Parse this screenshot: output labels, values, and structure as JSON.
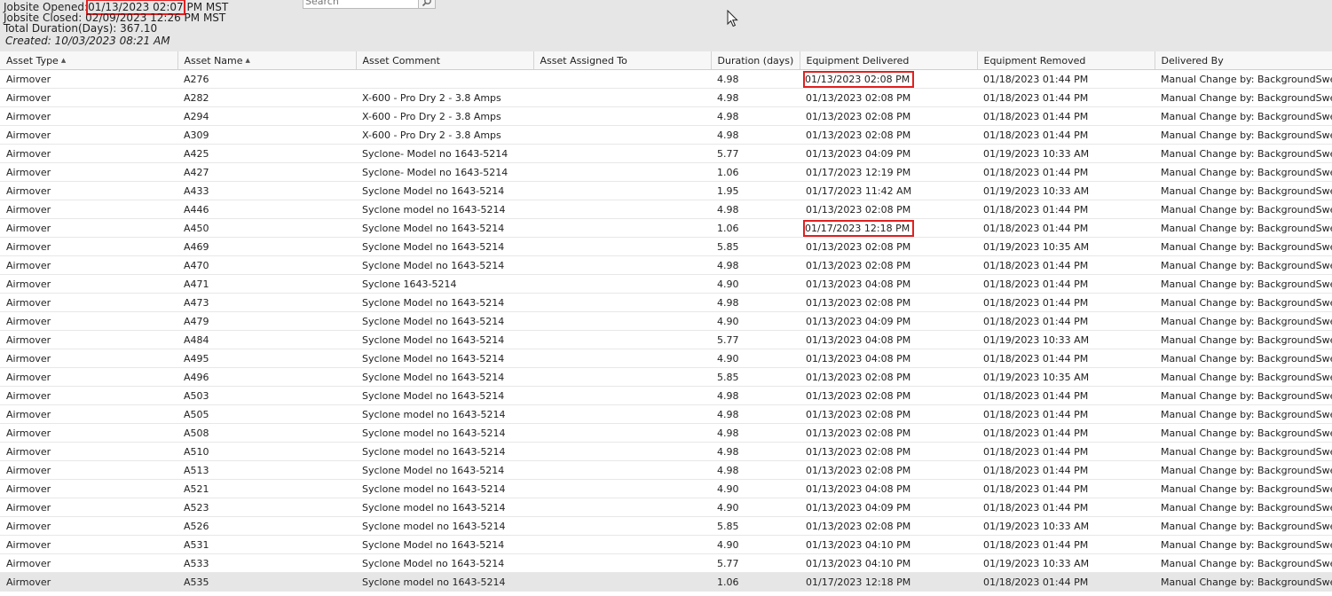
{
  "header": {
    "opened_label": "Jobsite Opened:",
    "opened_value": "01/13/2023 02:07",
    "opened_suffix": "PM MST",
    "closed_label": "Jobsite Closed:",
    "closed_value": "02/09/2023 12:26 PM MST",
    "duration_label": "Total Duration(Days):",
    "duration_value": "367.10",
    "created_label": "Created:",
    "created_value": "10/03/2023 08:21 AM"
  },
  "search": {
    "placeholder": "Search",
    "icon": "magnifier-icon"
  },
  "table": {
    "columns": [
      {
        "label": "Asset Type",
        "sorted": "asc",
        "width": 200
      },
      {
        "label": "Asset Name",
        "sorted": "asc",
        "width": 201
      },
      {
        "label": "Asset Comment",
        "sorted": "",
        "width": 200
      },
      {
        "label": "Asset Assigned To",
        "sorted": "",
        "width": 200
      },
      {
        "label": "Duration (days)",
        "sorted": "",
        "width": 100
      },
      {
        "label": "Equipment Delivered",
        "sorted": "",
        "width": 200
      },
      {
        "label": "Equipment Removed",
        "sorted": "",
        "width": 200
      },
      {
        "label": "Delivered By",
        "sorted": "",
        "width": 200
      }
    ],
    "rows": [
      [
        "Airmover",
        "A276",
        "",
        "",
        "4.98",
        "01/13/2023 02:08 PM",
        "01/18/2023 01:44 PM",
        "Manual Change by: BackgroundSweep"
      ],
      [
        "Airmover",
        "A282",
        "X-600 - Pro Dry 2 - 3.8 Amps",
        "",
        "4.98",
        "01/13/2023 02:08 PM",
        "01/18/2023 01:44 PM",
        "Manual Change by: BackgroundSweep"
      ],
      [
        "Airmover",
        "A294",
        "X-600 - Pro Dry 2 - 3.8 Amps",
        "",
        "4.98",
        "01/13/2023 02:08 PM",
        "01/18/2023 01:44 PM",
        "Manual Change by: BackgroundSweep"
      ],
      [
        "Airmover",
        "A309",
        "X-600 - Pro Dry 2 - 3.8 Amps",
        "",
        "4.98",
        "01/13/2023 02:08 PM",
        "01/18/2023 01:44 PM",
        "Manual Change by: BackgroundSweep"
      ],
      [
        "Airmover",
        "A425",
        "Syclone- Model no 1643-5214",
        "",
        "5.77",
        "01/13/2023 04:09 PM",
        "01/19/2023 10:33 AM",
        "Manual Change by: BackgroundSweep"
      ],
      [
        "Airmover",
        "A427",
        "Syclone- Model no 1643-5214",
        "",
        "1.06",
        "01/17/2023 12:19 PM",
        "01/18/2023 01:44 PM",
        "Manual Change by: BackgroundSweep"
      ],
      [
        "Airmover",
        "A433",
        "Syclone Model no 1643-5214",
        "",
        "1.95",
        "01/17/2023 11:42 AM",
        "01/19/2023 10:33 AM",
        "Manual Change by: BackgroundSweep"
      ],
      [
        "Airmover",
        "A446",
        "Syclone model no 1643-5214",
        "",
        "4.98",
        "01/13/2023 02:08 PM",
        "01/18/2023 01:44 PM",
        "Manual Change by: BackgroundSweep"
      ],
      [
        "Airmover",
        "A450",
        "Syclone Model no 1643-5214",
        "",
        "1.06",
        "01/17/2023 12:18 PM",
        "01/18/2023 01:44 PM",
        "Manual Change by: BackgroundSweep"
      ],
      [
        "Airmover",
        "A469",
        "Syclone Model no 1643-5214",
        "",
        "5.85",
        "01/13/2023 02:08 PM",
        "01/19/2023 10:35 AM",
        "Manual Change by: BackgroundSweep"
      ],
      [
        "Airmover",
        "A470",
        "Syclone Model no 1643-5214",
        "",
        "4.98",
        "01/13/2023 02:08 PM",
        "01/18/2023 01:44 PM",
        "Manual Change by: BackgroundSweep"
      ],
      [
        "Airmover",
        "A471",
        "Syclone 1643-5214",
        "",
        "4.90",
        "01/13/2023 04:08 PM",
        "01/18/2023 01:44 PM",
        "Manual Change by: BackgroundSweep"
      ],
      [
        "Airmover",
        "A473",
        "Syclone Model no 1643-5214",
        "",
        "4.98",
        "01/13/2023 02:08 PM",
        "01/18/2023 01:44 PM",
        "Manual Change by: BackgroundSweep"
      ],
      [
        "Airmover",
        "A479",
        "Syclone Model no 1643-5214",
        "",
        "4.90",
        "01/13/2023 04:09 PM",
        "01/18/2023 01:44 PM",
        "Manual Change by: BackgroundSweep"
      ],
      [
        "Airmover",
        "A484",
        "Syclone Model no 1643-5214",
        "",
        "5.77",
        "01/13/2023 04:08 PM",
        "01/19/2023 10:33 AM",
        "Manual Change by: BackgroundSweep"
      ],
      [
        "Airmover",
        "A495",
        "Syclone Model no 1643-5214",
        "",
        "4.90",
        "01/13/2023 04:08 PM",
        "01/18/2023 01:44 PM",
        "Manual Change by: BackgroundSweep"
      ],
      [
        "Airmover",
        "A496",
        "Syclone Model no 1643-5214",
        "",
        "5.85",
        "01/13/2023 02:08 PM",
        "01/19/2023 10:35 AM",
        "Manual Change by: BackgroundSweep"
      ],
      [
        "Airmover",
        "A503",
        "Syclone Model no 1643-5214",
        "",
        "4.98",
        "01/13/2023 02:08 PM",
        "01/18/2023 01:44 PM",
        "Manual Change by: BackgroundSweep"
      ],
      [
        "Airmover",
        "A505",
        "Syclone model no 1643-5214",
        "",
        "4.98",
        "01/13/2023 02:08 PM",
        "01/18/2023 01:44 PM",
        "Manual Change by: BackgroundSweep"
      ],
      [
        "Airmover",
        "A508",
        "Syclone model no 1643-5214",
        "",
        "4.98",
        "01/13/2023 02:08 PM",
        "01/18/2023 01:44 PM",
        "Manual Change by: BackgroundSweep"
      ],
      [
        "Airmover",
        "A510",
        "Syclone model no 1643-5214",
        "",
        "4.98",
        "01/13/2023 02:08 PM",
        "01/18/2023 01:44 PM",
        "Manual Change by: BackgroundSweep"
      ],
      [
        "Airmover",
        "A513",
        "Syclone Model no 1643-5214",
        "",
        "4.98",
        "01/13/2023 02:08 PM",
        "01/18/2023 01:44 PM",
        "Manual Change by: BackgroundSweep"
      ],
      [
        "Airmover",
        "A521",
        "Syclone model no 1643-5214",
        "",
        "4.90",
        "01/13/2023 04:08 PM",
        "01/18/2023 01:44 PM",
        "Manual Change by: BackgroundSweep"
      ],
      [
        "Airmover",
        "A523",
        "Syclone model no 1643-5214",
        "",
        "4.90",
        "01/13/2023 04:09 PM",
        "01/18/2023 01:44 PM",
        "Manual Change by: BackgroundSweep"
      ],
      [
        "Airmover",
        "A526",
        "Syclone model no 1643-5214",
        "",
        "5.85",
        "01/13/2023 02:08 PM",
        "01/19/2023 10:33 AM",
        "Manual Change by: BackgroundSweep"
      ],
      [
        "Airmover",
        "A531",
        "Syclone Model no 1643-5214",
        "",
        "4.90",
        "01/13/2023 04:10 PM",
        "01/18/2023 01:44 PM",
        "Manual Change by: BackgroundSweep"
      ],
      [
        "Airmover",
        "A533",
        "Syclone Model no 1643-5214",
        "",
        "5.77",
        "01/13/2023 04:10 PM",
        "01/19/2023 10:33 AM",
        "Manual Change by: BackgroundSweep"
      ],
      [
        "Airmover",
        "A535",
        "Syclone model no 1643-5214",
        "",
        "1.06",
        "01/17/2023 12:18 PM",
        "01/18/2023 01:44 PM",
        "Manual Change by: BackgroundSweep"
      ]
    ],
    "highlighted_cells": [
      [
        0,
        5
      ],
      [
        8,
        5
      ]
    ]
  },
  "colors": {
    "header_band": "#e6e6e6",
    "highlight_box": "#e02020",
    "last_row_bg": "#e6e6e6"
  }
}
